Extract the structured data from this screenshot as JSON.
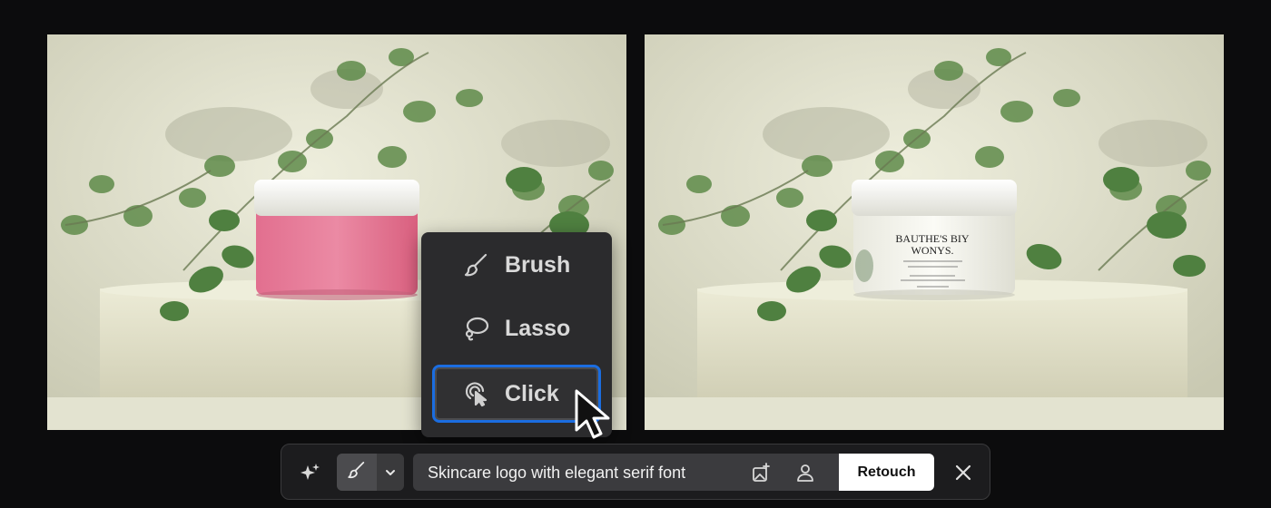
{
  "selection_menu": {
    "items": [
      {
        "label": "Brush",
        "icon": "brush-icon"
      },
      {
        "label": "Lasso",
        "icon": "lasso-icon"
      },
      {
        "label": "Click",
        "icon": "click-icon",
        "selected": true
      }
    ]
  },
  "product_label": {
    "brand_line1": "BAUTHE'S BIY",
    "brand_line2": "WONYS."
  },
  "toolbar": {
    "prompt_value": "Skincare logo with elegant serif font",
    "retouch_label": "Retouch",
    "icons": [
      "sparkle-icon",
      "brush-icon",
      "chevron-down-icon",
      "image-reference-icon",
      "person-icon",
      "close-icon"
    ]
  },
  "colors": {
    "accent_selection": "#1b6de0",
    "jar_pink": "#e57b98",
    "jar_white": "#f0efe8"
  }
}
